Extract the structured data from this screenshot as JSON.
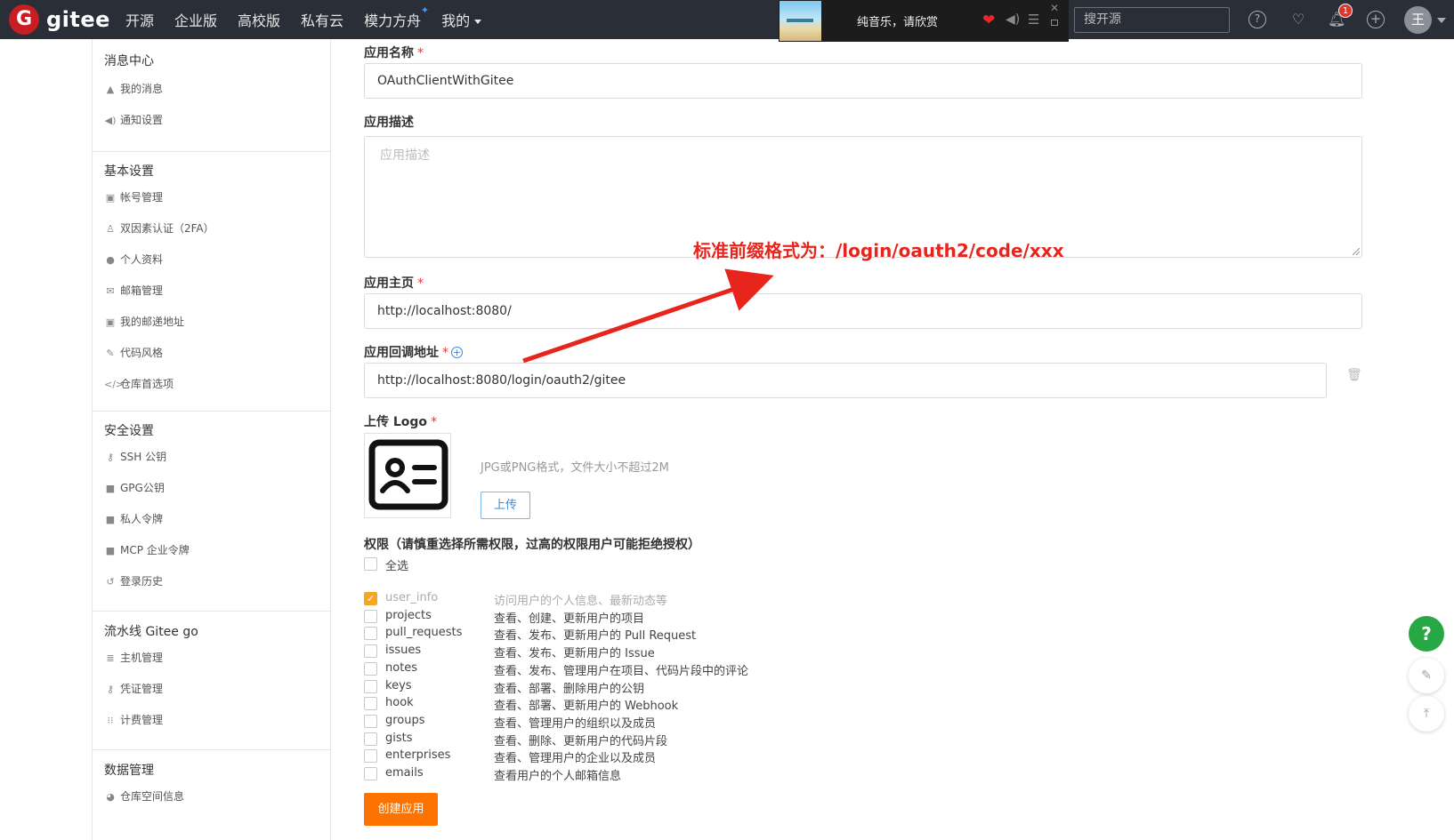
{
  "brand": {
    "name": "gitee",
    "logo_letter": "G",
    "color": "#c71d23"
  },
  "nav": {
    "items": [
      "开源",
      "企业版",
      "高校版",
      "私有云",
      "模力方舟",
      "我的"
    ],
    "sparkle_icon": "sparkle-icon"
  },
  "player": {
    "title": "纯音乐，请欣赏"
  },
  "search": {
    "placeholder": "搜开源"
  },
  "notifications": {
    "count": "1"
  },
  "user": {
    "avatar_text": "王"
  },
  "sidebar": {
    "sections": [
      {
        "title": "消息中心",
        "items": [
          {
            "icon": "bell-icon",
            "label": "我的消息"
          },
          {
            "icon": "speaker-icon",
            "label": "通知设置"
          }
        ]
      },
      {
        "title": "基本设置",
        "items": [
          {
            "icon": "id-card-icon",
            "label": "帐号管理"
          },
          {
            "icon": "user-shield-icon",
            "label": "双因素认证（2FA）"
          },
          {
            "icon": "user-icon",
            "label": "个人资料"
          },
          {
            "icon": "mail-icon",
            "label": "邮箱管理"
          },
          {
            "icon": "address-card-icon",
            "label": "我的邮递地址"
          },
          {
            "icon": "brush-icon",
            "label": "代码风格"
          },
          {
            "icon": "code-icon",
            "label": "仓库首选项"
          }
        ]
      },
      {
        "title": "安全设置",
        "items": [
          {
            "icon": "key-icon",
            "label": "SSH 公钥"
          },
          {
            "icon": "lock-icon",
            "label": "GPG公钥"
          },
          {
            "icon": "lock-icon",
            "label": "私人令牌"
          },
          {
            "icon": "lock-icon",
            "label": "MCP 企业令牌"
          },
          {
            "icon": "history-icon",
            "label": "登录历史"
          }
        ]
      },
      {
        "title": "流水线 Gitee go",
        "items": [
          {
            "icon": "server-icon",
            "label": "主机管理"
          },
          {
            "icon": "key-icon",
            "label": "凭证管理"
          },
          {
            "icon": "billing-icon",
            "label": "计费管理"
          }
        ]
      },
      {
        "title": "数据管理",
        "items": [
          {
            "icon": "pie-chart-icon",
            "label": "仓库空间信息"
          }
        ]
      }
    ]
  },
  "form": {
    "app_name_label": "应用名称",
    "app_name_value": "OAuthClientWithGitee",
    "app_desc_label": "应用描述",
    "app_desc_placeholder": "应用描述",
    "homepage_label": "应用主页",
    "homepage_value": "http://localhost:8080/",
    "callback_label": "应用回调地址",
    "callback_value": "http://localhost:8080/login/oauth2/gitee",
    "logo_label": "上传 Logo",
    "logo_hint": "JPG或PNG格式，文件大小不超过2M",
    "upload_button": "上传",
    "permissions_label": "权限（请慎重选择所需权限，过高的权限用户可能拒绝授权）",
    "select_all_label": "全选",
    "scopes": [
      {
        "name": "user_info",
        "desc": "访问用户的个人信息、最新动态等",
        "checked": true,
        "locked": true
      },
      {
        "name": "projects",
        "desc": "查看、创建、更新用户的项目",
        "checked": false,
        "locked": false
      },
      {
        "name": "pull_requests",
        "desc": "查看、发布、更新用户的 Pull Request",
        "checked": false,
        "locked": false
      },
      {
        "name": "issues",
        "desc": "查看、发布、更新用户的 Issue",
        "checked": false,
        "locked": false
      },
      {
        "name": "notes",
        "desc": "查看、发布、管理用户在项目、代码片段中的评论",
        "checked": false,
        "locked": false
      },
      {
        "name": "keys",
        "desc": "查看、部署、删除用户的公钥",
        "checked": false,
        "locked": false
      },
      {
        "name": "hook",
        "desc": "查看、部署、更新用户的 Webhook",
        "checked": false,
        "locked": false
      },
      {
        "name": "groups",
        "desc": "查看、管理用户的组织以及成员",
        "checked": false,
        "locked": false
      },
      {
        "name": "gists",
        "desc": "查看、删除、更新用户的代码片段",
        "checked": false,
        "locked": false
      },
      {
        "name": "enterprises",
        "desc": "查看、管理用户的企业以及成员",
        "checked": false,
        "locked": false
      },
      {
        "name": "emails",
        "desc": "查看用户的个人邮箱信息",
        "checked": false,
        "locked": false
      }
    ],
    "create_button": "创建应用"
  },
  "annotation": {
    "text": "标准前缀格式为：/login/oauth2/code/xxx",
    "color": "#e8251d"
  },
  "floating": {
    "help": "?"
  }
}
